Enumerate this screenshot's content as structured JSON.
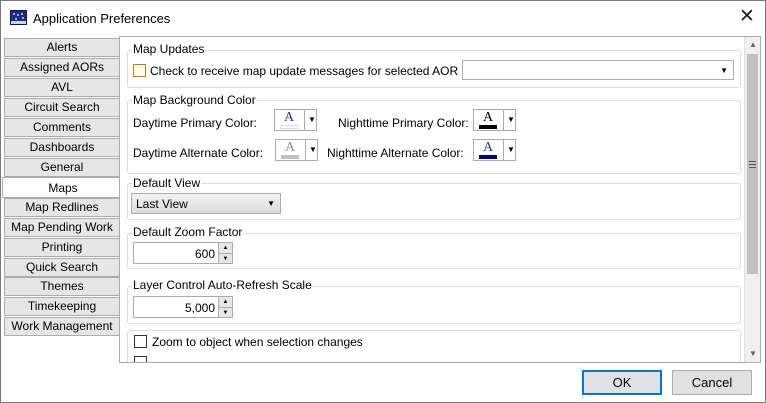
{
  "window": {
    "title": "Application Preferences",
    "close_glyph": "✕"
  },
  "tabs": [
    {
      "label": "Alerts"
    },
    {
      "label": "Assigned AORs"
    },
    {
      "label": "AVL"
    },
    {
      "label": "Circuit Search"
    },
    {
      "label": "Comments"
    },
    {
      "label": "Dashboards"
    },
    {
      "label": "General"
    },
    {
      "label": "Maps"
    },
    {
      "label": "Map Redlines"
    },
    {
      "label": "Map Pending Work"
    },
    {
      "label": "Printing"
    },
    {
      "label": "Quick Search"
    },
    {
      "label": "Themes"
    },
    {
      "label": "Timekeeping"
    },
    {
      "label": "Work Management"
    }
  ],
  "active_tab": "Maps",
  "maps": {
    "map_updates": {
      "title": "Map Updates",
      "checkbox_label": "Check to receive map update messages for selected AOR",
      "checked": false,
      "aor_value": ""
    },
    "background": {
      "title": "Map Background Color",
      "daytime_primary_label": "Daytime Primary Color:",
      "nighttime_primary_label": "Nighttime Primary Color:",
      "daytime_alternate_label": "Daytime Alternate Color:",
      "nighttime_alternate_label": "Nighttime Alternate Color:",
      "letter": "A",
      "daytime_primary_swatch": "#ffffff",
      "nighttime_primary_swatch": "#000000",
      "daytime_alternate_swatch": "#c0c0c0",
      "nighttime_alternate_swatch": "#00008b"
    },
    "default_view": {
      "title": "Default View",
      "value": "Last View"
    },
    "zoom": {
      "title": "Default Zoom Factor",
      "value": "600"
    },
    "layer": {
      "title": "Layer Control Auto-Refresh Scale",
      "value": "5,000"
    },
    "options": {
      "zoom_select_label": "Zoom to object when selection changes",
      "zoom_select_checked": false
    }
  },
  "buttons": {
    "ok": "OK",
    "cancel": "Cancel"
  },
  "colors": {
    "accent": "#0078d7",
    "tab_bg": "#e6e6e6"
  }
}
